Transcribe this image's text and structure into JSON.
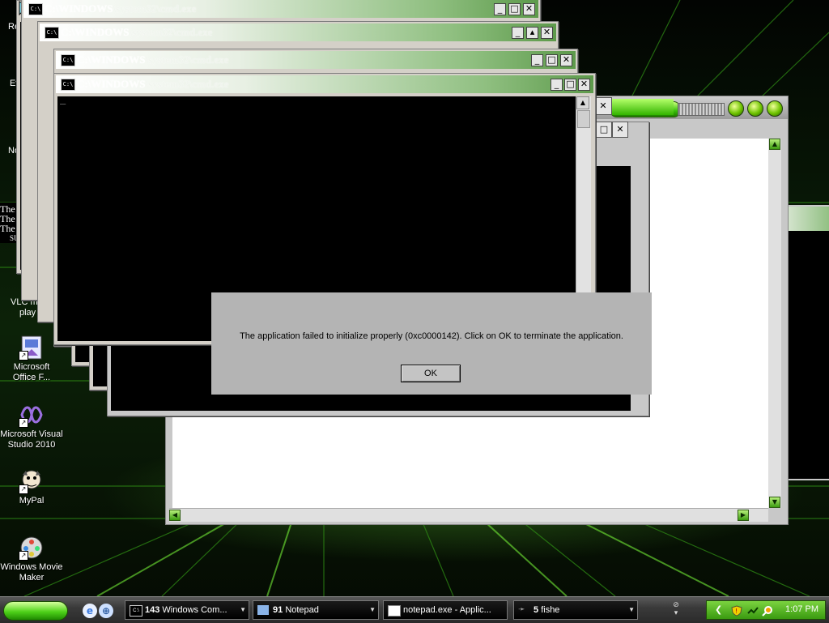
{
  "desktop": {
    "icons": [
      {
        "label": "Microsoft\nOffice F...",
        "line1": "Microsoft",
        "line2": "Office F...",
        "icon": "office-icon"
      },
      {
        "label": "Microsoft Visual Studio 2010",
        "line1": "Microsoft Visual",
        "line2": "Studio 2010",
        "icon": "visual-studio-icon"
      },
      {
        "label": "MyPal",
        "line1": "MyPal",
        "line2": "",
        "icon": "mypal-icon"
      },
      {
        "label": "Windows Movie Maker",
        "line1": "Windows Movie",
        "line2": "Maker",
        "icon": "movie-maker-icon"
      }
    ],
    "partial_labels": {
      "re": "Re",
      "ev": "Ev",
      "no": "No",
      "vlc1": "VLC m",
      "vlc2": "play",
      "the1": "The",
      "the2": "The",
      "the3": "The",
      "su": "SU"
    }
  },
  "cmd_windows": {
    "title_prefix": "C:\\WINDOWS",
    "title_rest": "\\system32\\cmd.exe",
    "icon_text": "C:\\",
    "cursor": "_"
  },
  "window_controls": {
    "minimize": "_",
    "maximize": "□",
    "close": "✕"
  },
  "dialog": {
    "message": "The application failed to initialize properly (0xc0000142). Click on OK to terminate the application.",
    "ok_label": "OK"
  },
  "taskbar": {
    "tasks": [
      {
        "count": "143",
        "label": "Windows Com...",
        "icon": "cmd-icon"
      },
      {
        "count": "91",
        "label": "Notepad",
        "icon": "notepad-icon"
      },
      {
        "count": "",
        "label": "notepad.exe - Applic...",
        "icon": "window-icon"
      },
      {
        "count": "5",
        "label": "fishe",
        "icon": "fish-icon"
      }
    ],
    "clock": "1:07 PM"
  }
}
